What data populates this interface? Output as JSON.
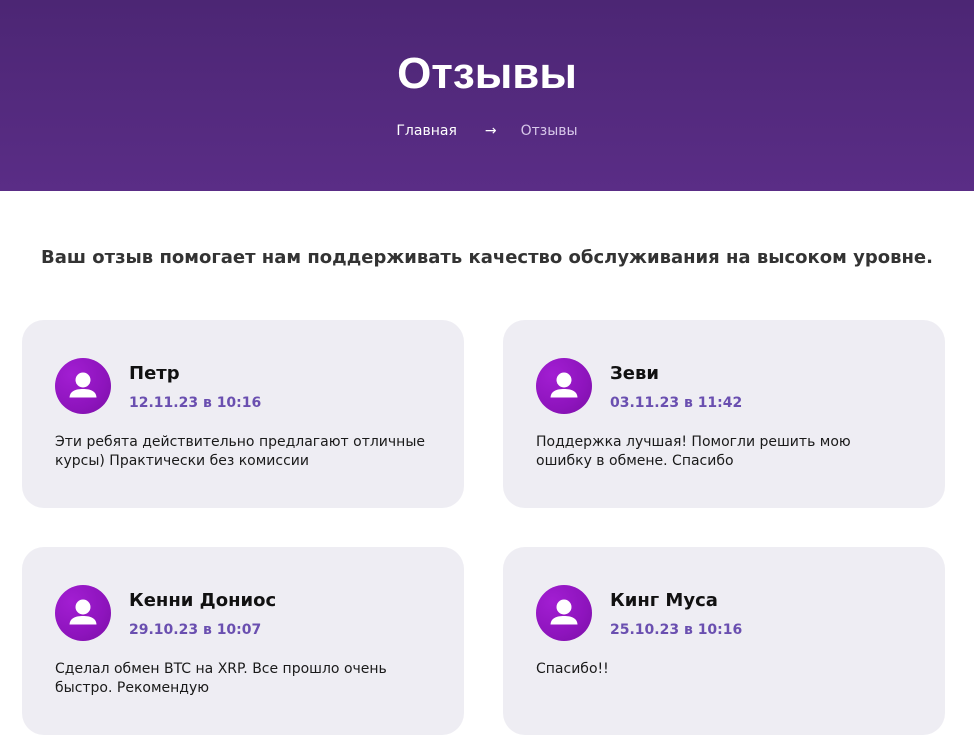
{
  "header": {
    "title": "Отзывы",
    "breadcrumb": {
      "home": "Главная",
      "separator": "→",
      "current": "Отзывы"
    }
  },
  "intro": "Ваш отзыв помогает нам поддерживать качество обслуживания на высоком уровне.",
  "reviews": [
    {
      "name": "Петр",
      "date": "12.11.23 в 10:16",
      "text": "Эти ребята действительно предлагают отличные курсы) Практически без комиссии",
      "avatar_icon": "user-icon"
    },
    {
      "name": "Зеви",
      "date": "03.11.23 в 11:42",
      "text": "Поддержка лучшая! Помогли решить мою ошибку в обмене. Спасибо",
      "avatar_icon": "user-icon"
    },
    {
      "name": "Кенни Дониос",
      "date": "29.10.23 в 10:07",
      "text": "Сделал обмен BTC на XRP. Все прошло очень быстро. Рекомендую",
      "avatar_icon": "user-icon"
    },
    {
      "name": "Кинг Муса",
      "date": "25.10.23 в 10:16",
      "text": "Спасибо!!",
      "avatar_icon": "user-icon"
    }
  ],
  "colors": {
    "header_bg": "#4c2674",
    "card_bg": "#eeedf3",
    "avatar_bg": "#8e14bd",
    "date_color": "#6a4fb0"
  }
}
